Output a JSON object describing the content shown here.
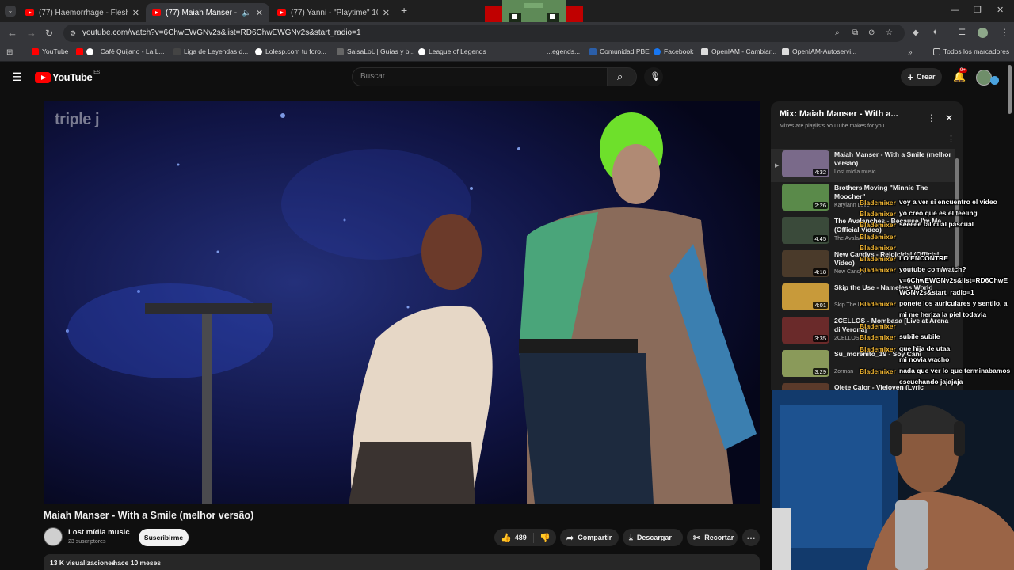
{
  "browser": {
    "tabs": [
      {
        "title": "(77) Haemorrhage - Flesh-devo"
      },
      {
        "title": "(77) Maiah Manser - With a"
      },
      {
        "title": "(77) Yanni - \"Playtime\" 1080p I"
      }
    ],
    "url": "youtube.com/watch?v=6ChwEWGNv2s&list=RD6ChwEWGNv2s&start_radio=1",
    "bookmarks": [
      "YouTube",
      "_Café Quijano - La L...",
      "Liga de Leyendas d...",
      "Lolesp.com tu foro...",
      "SalsaLoL | Guías y b...",
      "League of Legends",
      "...egends...",
      "Comunidad PBE",
      "Facebook",
      "OpenIAM - Cambiar...",
      "OpenIAM-Autoservi..."
    ],
    "all_bookmarks": "Todos los marcadores"
  },
  "youtube": {
    "logo": "YouTube",
    "region": "ES",
    "search_placeholder": "Buscar",
    "create_label": "Crear",
    "notif_count": "9+"
  },
  "video": {
    "watermark": "triple j",
    "title": "Maiah Manser - With a Smile (melhor versão)",
    "channel": "Lost mídia music",
    "subscribers": "23 suscriptores",
    "subscribe_label": "Suscribirme",
    "likes": "489",
    "share_label": "Compartir",
    "download_label": "Descargar",
    "clip_label": "Recortar",
    "views": "13 K visualizaciones",
    "age": "hace 10 meses"
  },
  "playlist": {
    "title": "Mix: Maiah Manser - With a...",
    "subtitle": "Mixes are playlists YouTube makes for you",
    "items": [
      {
        "title": "Maiah Manser - With a Smile (melhor versão)",
        "channel": "Lost mídia music",
        "duration": "4:32"
      },
      {
        "title": "Brothers Moving \"Minnie The Moocher\"",
        "channel": "Karylann Love",
        "duration": "2:26"
      },
      {
        "title": "The Avalanches - Because I'm Me (Official Video)",
        "channel": "The Avalanches",
        "duration": "4:45"
      },
      {
        "title": "New Candys - Rejoicidal (Official Video)",
        "channel": "New Candys",
        "duration": "4:18"
      },
      {
        "title": "Skip the Use - Nameless World",
        "channel": "Skip The Use",
        "duration": "4:01"
      },
      {
        "title": "2CELLOS - Mombasa [Live at Arena di Verona]",
        "channel": "2CELLOS",
        "duration": "3:35"
      },
      {
        "title": "Su_morenito_19 - Soy Cani",
        "channel": "Zorman",
        "duration": "3:29"
      },
      {
        "title": "Ojete Calor - Viejoven (Lyric",
        "channel": "",
        "duration": ""
      }
    ]
  },
  "chat": {
    "user": "Blademixer",
    "messages": [
      "voy a ver si encuentro el video",
      "yo creo que es el feeling",
      "seeeee tal cual pascual",
      "",
      "",
      "LO ENCONTRE",
      "youtube com/watch?",
      "v=6ChwEWGNv2s&list=RD6ChwE",
      "WGNv2s&start_radio=1",
      "ponete los auriculares y sentilo, a",
      "mi me heriza la piel todavia",
      "",
      "subile subile",
      "que hija de utaa",
      "mi novia wacho",
      "nada que ver lo que terminabamos",
      "escuchando jajajaja"
    ]
  },
  "colors": {
    "youtube_red": "#ff0000",
    "background": "#0f0f0f",
    "panel": "#272727",
    "chat_user": "#f2b632"
  }
}
